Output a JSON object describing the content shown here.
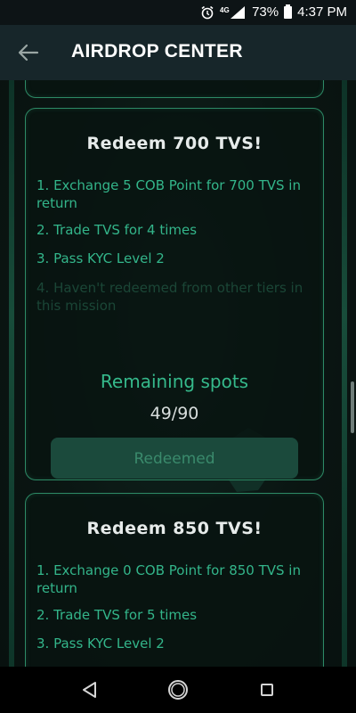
{
  "status_bar": {
    "network_label": "4G",
    "battery": "73%",
    "time": "4:37 PM"
  },
  "app_bar": {
    "title": "AIRDROP CENTER"
  },
  "tiers": [
    {
      "title": "Redeem 700 TVS!",
      "requirements": [
        "1. Exchange 5 COB Point for 700 TVS in return",
        "2. Trade TVS for 4 times",
        "3. Pass KYC Level 2",
        "4. Haven't redeemed from other tiers in this mission"
      ],
      "remaining_label": "Remaining spots",
      "remaining": "49/90",
      "button_label": "Redeemed"
    },
    {
      "title": "Redeem 850 TVS!",
      "requirements": [
        "1. Exchange 0 COB Point for 850 TVS in return",
        "2. Trade TVS for 5 times",
        "3. Pass KYC Level 2"
      ]
    }
  ],
  "colors": {
    "accent": "#33b58a",
    "card_border": "#2d8a66",
    "app_bar": "#17262a",
    "button_bg": "#1b4a3c"
  }
}
